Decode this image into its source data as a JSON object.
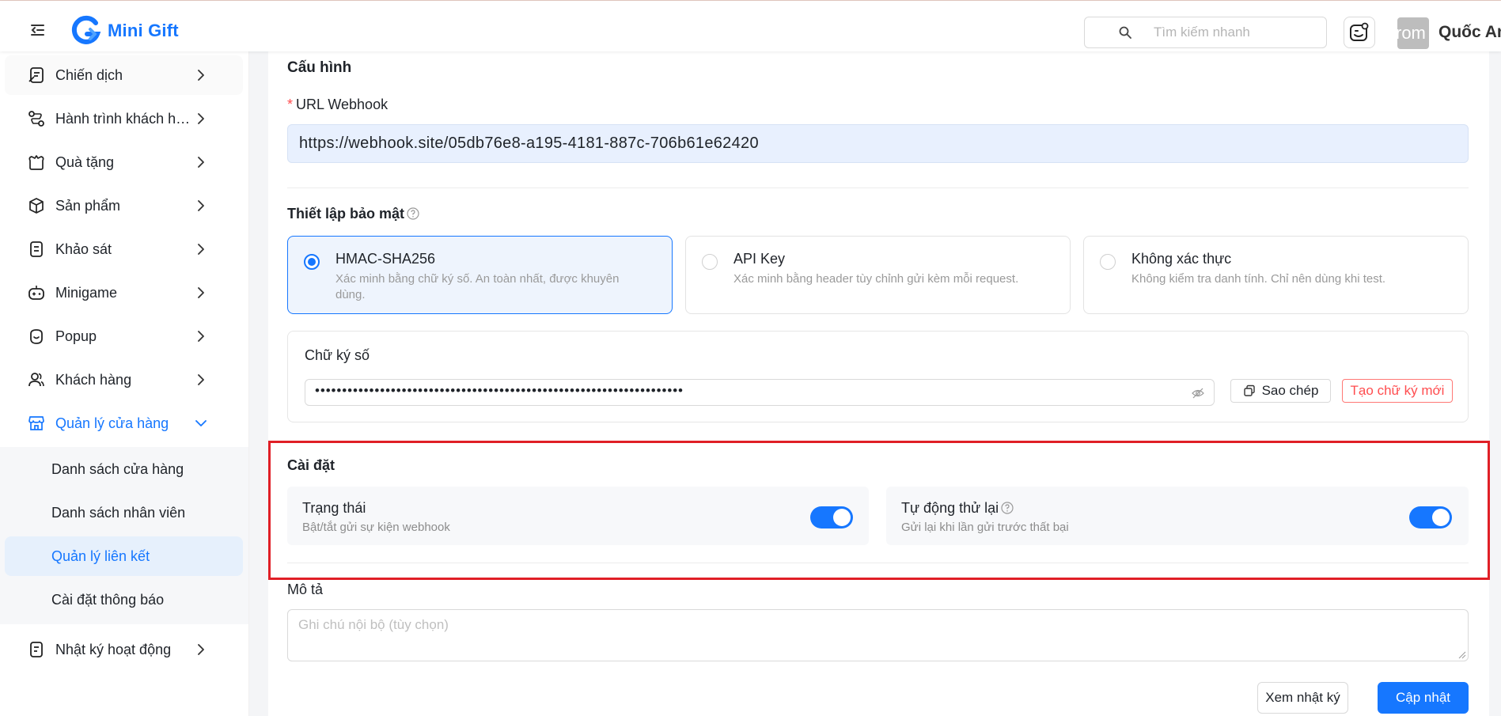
{
  "header": {
    "logo_text": "Mini Gift",
    "search_placeholder": "Tìm kiếm nhanh",
    "avatar_text": "rom",
    "username": "Quốc An"
  },
  "sidebar": {
    "items": [
      {
        "label": "Chiến dịch",
        "icon": "campaign-icon"
      },
      {
        "label": "Hành trình khách hàng",
        "icon": "journey-icon"
      },
      {
        "label": "Quà tặng",
        "icon": "gift-icon"
      },
      {
        "label": "Sản phẩm",
        "icon": "box-icon"
      },
      {
        "label": "Khảo sát",
        "icon": "survey-icon"
      },
      {
        "label": "Minigame",
        "icon": "game-icon"
      },
      {
        "label": "Popup",
        "icon": "popup-icon"
      },
      {
        "label": "Khách hàng",
        "icon": "users-icon"
      },
      {
        "label": "Quản lý cửa hàng",
        "icon": "store-icon"
      },
      {
        "label": "Nhật ký hoạt động",
        "icon": "log-icon"
      }
    ],
    "submenu": [
      {
        "label": "Danh sách cửa hàng"
      },
      {
        "label": "Danh sách nhân viên"
      },
      {
        "label": "Quản lý liên kết"
      },
      {
        "label": "Cài đặt thông báo"
      }
    ]
  },
  "config": {
    "title": "Cấu hình",
    "url_label": "URL Webhook",
    "url_value": "https://webhook.site/05db76e8-a195-4181-887c-706b61e62420"
  },
  "security": {
    "title": "Thiết lập bảo mật",
    "options": [
      {
        "title": "HMAC-SHA256",
        "desc": "Xác minh bằng chữ ký số. An toàn nhất, được khuyên dùng."
      },
      {
        "title": "API Key",
        "desc": "Xác minh bằng header tùy chỉnh gửi kèm mỗi request."
      },
      {
        "title": "Không xác thực",
        "desc": "Không kiểm tra danh tính. Chỉ nên dùng khi test."
      }
    ],
    "selected": "HMAC-SHA256",
    "signature_label": "Chữ ký số",
    "signature_masked": "••••••••••••••••••••••••••••••••••••••••••••••••••••••••••••••••••••",
    "copy_label": "Sao chép",
    "regen_label": "Tạo chữ ký mới"
  },
  "settings": {
    "title": "Cài đặt",
    "status": {
      "title": "Trạng thái",
      "desc": "Bật/tắt gửi sự kiện webhook",
      "enabled": true
    },
    "retry": {
      "title": "Tự động thử lại",
      "desc": "Gửi lại khi lần gửi trước thất bại",
      "enabled": true
    }
  },
  "description": {
    "label": "Mô tả",
    "placeholder": "Ghi chú nội bộ (tùy chọn)"
  },
  "actions": {
    "view_log": "Xem nhật ký",
    "update": "Cập nhật"
  },
  "colors": {
    "primary": "#1677ff",
    "danger": "#ff4d4f",
    "highlight": "#e01f26"
  }
}
